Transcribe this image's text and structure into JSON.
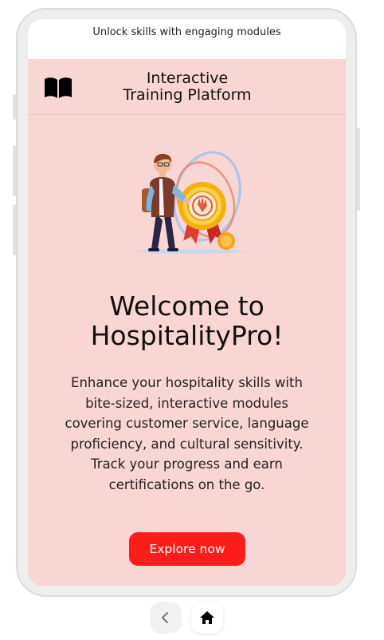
{
  "status_bar": {
    "tagline": "Unlock skills with engaging modules"
  },
  "header": {
    "icon": "book-open-icon",
    "title_line1": "Interactive",
    "title_line2": "Training Platform"
  },
  "hero": {
    "illustration": "person-with-medal-illustration"
  },
  "welcome": {
    "title_line1": "Welcome to",
    "title_line2": "HospitalityPro!",
    "description": "Enhance your hospitality skills with bite-sized, interactive modules covering customer service, language proficiency, and cultural sensitivity. Track your progress and earn certifications on the go."
  },
  "cta": {
    "label": "Explore now",
    "color": "#fb1c1c"
  },
  "bottom_nav": {
    "back_icon": "chevron-left-icon",
    "home_icon": "home-icon"
  },
  "colors": {
    "screen_background": "#f8d6d4",
    "frame": "#eeeeee"
  }
}
